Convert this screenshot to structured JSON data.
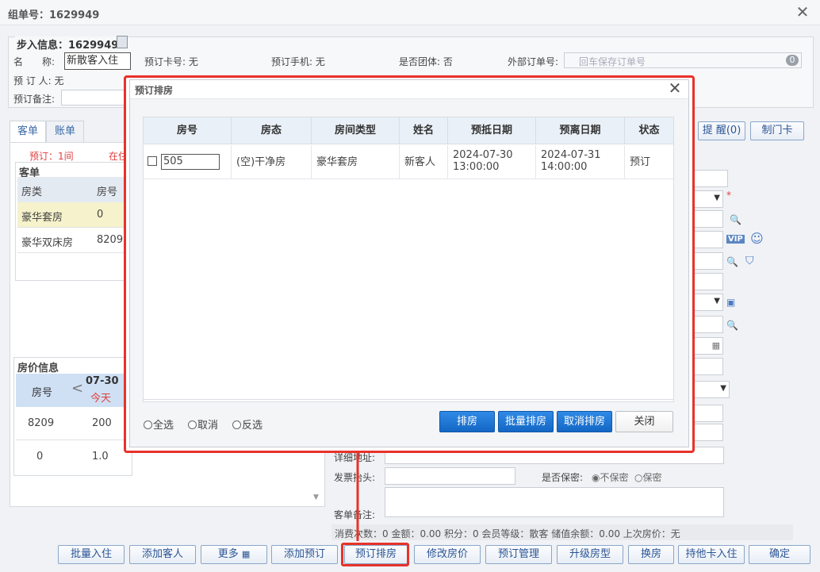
{
  "window": {
    "title": "组单号：1629949",
    "close": "✕"
  },
  "checkin": {
    "section_title": "步入信息：1629949",
    "fields": {
      "name_label": "名　　称:",
      "name_value": "新散客入住",
      "card_label": "预订卡号: 无",
      "phone_label": "预订手机: 无",
      "group_label": "是否团体: 否",
      "ext_order_label": "外部订单号:",
      "ext_order_placeholder": "回车保存订单号",
      "ext_order_count": "0",
      "booker_label": "预 订 人: 无",
      "remark_label": "预订备注:"
    }
  },
  "left_tabs": [
    "客单",
    "账单"
  ],
  "left_status": [
    "预订：1间",
    "在住"
  ],
  "guest_list": {
    "title": "客单",
    "headers": [
      "房类",
      "房号"
    ],
    "rows": [
      {
        "type": "豪华套房",
        "room": "0"
      },
      {
        "type": "豪华双床房",
        "room": "8209"
      }
    ]
  },
  "price_info": {
    "title": "房价信息",
    "headers": {
      "room": "房号",
      "prev": "<",
      "date": "07-30",
      "today": "今天"
    },
    "rows": [
      {
        "room": "8209",
        "price": "200"
      },
      {
        "room": "0",
        "price": "1.0"
      }
    ]
  },
  "right_top_buttons": [
    "提 醒(0)",
    "制门卡"
  ],
  "right_form": {
    "address_label": "详细地址:",
    "invoice_label": "发票抬头:",
    "secret_label": "是否保密:",
    "secret_options": [
      "不保密",
      "保密"
    ],
    "remark_label": "客单备注:",
    "stats": "消费次数：0 金额：0.00 积分：0 会员等级：散客 储值余额：0.00 上次房价：无",
    "vip": "VIP"
  },
  "bottom_buttons": [
    "批量入住",
    "添加客人",
    "更多",
    "添加预订",
    "预订排房",
    "修改房价",
    "预订管理",
    "升级房型",
    "换房",
    "持他卡入住",
    "确定"
  ],
  "modal": {
    "title": "预订排房",
    "close": "✕",
    "headers": [
      "房号",
      "房态",
      "房间类型",
      "姓名",
      "预抵日期",
      "预离日期",
      "状态"
    ],
    "row": {
      "room": "505",
      "state": "(空)干净房",
      "room_type": "豪华套房",
      "name": "新客人",
      "arrive_date": "2024-07-30",
      "arrive_time": "13:00:00",
      "leave_date": "2024-07-31",
      "leave_time": "14:00:00",
      "status": "预订"
    },
    "radios": [
      "全选",
      "取消",
      "反选"
    ],
    "buttons": [
      "排房",
      "批量排房",
      "取消排房",
      "关闭"
    ]
  },
  "colors": {
    "highlight": "#e8322a",
    "primary": "#1467c4"
  }
}
